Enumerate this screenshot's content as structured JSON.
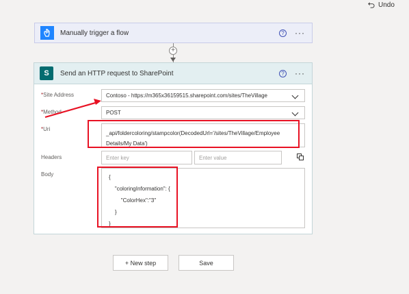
{
  "toolbar": {
    "undo_label": "Undo",
    "undo_icon": "undo-icon"
  },
  "trigger": {
    "title": "Manually trigger a flow",
    "icon": "touch-hand-icon",
    "help": "?",
    "more": "···"
  },
  "connector": {
    "add": "+"
  },
  "action": {
    "title": "Send an HTTP request to SharePoint",
    "icon": "sharepoint-icon",
    "help": "?",
    "more": "···",
    "fields": {
      "site_address": {
        "label": "Site Address",
        "value": "Contoso - https://m365x36159515.sharepoint.com/sites/TheVillage"
      },
      "method": {
        "label": "Method",
        "value": "POST"
      },
      "uri": {
        "label": "Uri",
        "line1": "_api/foldercoloring/stampcolor(DecodedUrl='/sites/TheVillage/Employee",
        "line2": "Details/My Data')"
      },
      "headers": {
        "label": "Headers",
        "key_placeholder": "Enter key",
        "value_placeholder": "Enter value"
      },
      "body": {
        "label": "Body",
        "text": "{\n    \"coloringInformation\": {\n        \"ColorHex\":\"3\"\n    }\n}"
      }
    }
  },
  "footer": {
    "new_step": "+ New step",
    "save": "Save"
  },
  "colors": {
    "annotation_red": "#e81123",
    "trigger_blue": "#1f85ff",
    "sharepoint_teal": "#036c70"
  }
}
